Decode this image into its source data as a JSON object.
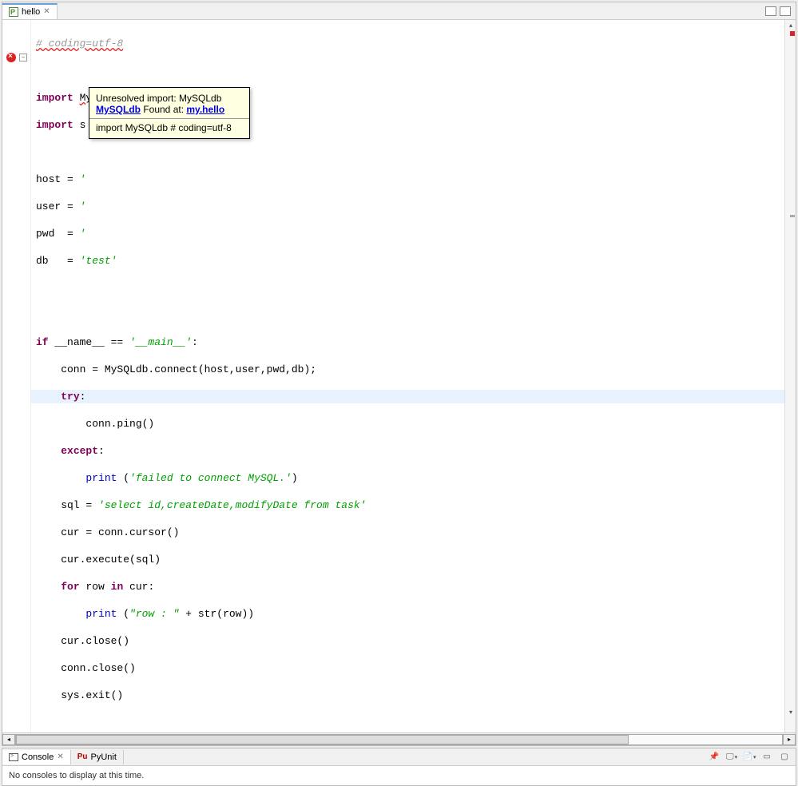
{
  "editor": {
    "tab": {
      "icon_label": "P",
      "title": "hello"
    },
    "code": {
      "l1": "# coding=utf-8",
      "l3_kw": "import",
      "l3_mod": "MySQLdb",
      "l4_kw": "import",
      "l4_mod": "s",
      "l6_a": "host = ",
      "l6_b": "'",
      "l7_a": "user = ",
      "l7_b": "'",
      "l8_a": "pwd  = ",
      "l8_b": "'",
      "l9_a": "db   = ",
      "l9_b": "'test'",
      "l12_kw": "if",
      "l12_a": " __name__ == ",
      "l12_s": "'__main__'",
      "l12_end": ":",
      "l13": "    conn = MySQLdb.connect(host,user,pwd,db);",
      "l14_kw": "try",
      "l14_end": ":",
      "l15": "        conn.ping()",
      "l16_kw": "except",
      "l16_end": ":",
      "l17_kw": "print",
      "l17_a": " (",
      "l17_s": "'failed to connect MySQL.'",
      "l17_end": ")",
      "l18_a": "    sql = ",
      "l18_s": "'select id,createDate,modifyDate from task'",
      "l19": "    cur = conn.cursor()",
      "l20": "    cur.execute(sql)",
      "l21_kw": "for",
      "l21_a": " row ",
      "l21_kw2": "in",
      "l21_b": " cur:",
      "l22_kw": "print",
      "l22_a": " (",
      "l22_s": "\"row : \"",
      "l22_b": " + str(row))",
      "l23": "    cur.close()",
      "l24": "    conn.close()",
      "l25": "    sys.exit()"
    },
    "tooltip": {
      "line1": "Unresolved import: MySQLdb",
      "link1": "MySQLdb",
      "found": " Found at: ",
      "link2": "my.hello",
      "line3": "import MySQLdb # coding=utf-8"
    }
  },
  "console": {
    "tab1": "Console",
    "tab2": "PyUnit",
    "pu_icon": "Pu",
    "body": "No consoles to display at this time."
  }
}
